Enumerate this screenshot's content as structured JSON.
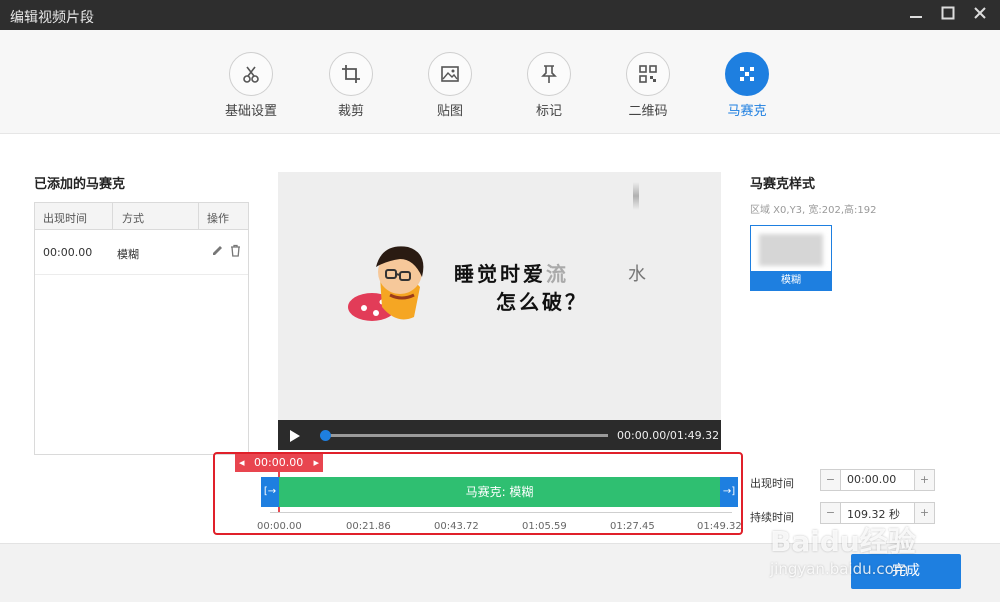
{
  "window": {
    "title": "编辑视频片段"
  },
  "toolbar": {
    "tabs": [
      {
        "label": "基础设置",
        "icon": "scissors-icon"
      },
      {
        "label": "裁剪",
        "icon": "crop-icon"
      },
      {
        "label": "贴图",
        "icon": "image-icon"
      },
      {
        "label": "标记",
        "icon": "pin-icon"
      },
      {
        "label": "二维码",
        "icon": "qrcode-icon"
      },
      {
        "label": "马赛克",
        "icon": "mosaic-icon",
        "active": true
      }
    ]
  },
  "added_list": {
    "title": "已添加的马赛克",
    "columns": [
      "出现时间",
      "方式",
      "操作"
    ],
    "rows": [
      {
        "time": "00:00.00",
        "mode": "模糊"
      }
    ]
  },
  "player": {
    "caption_line1": "睡觉时爱",
    "caption_line1_tail": "流",
    "caption_water": "水",
    "caption_line2": "怎么破？",
    "time": "00:00.00/01:49.32",
    "progress": 0.0
  },
  "mosaic_style": {
    "title": "马赛克样式",
    "region": "区域 X0,Y3, 宽:202,高:192",
    "selected": "模糊"
  },
  "timeline": {
    "current_tag": "00:00.00",
    "clip_label": "马赛克: 模糊",
    "ticks": [
      "00:00.00",
      "00:21.86",
      "00:43.72",
      "01:05.59",
      "01:27.45",
      "01:49.32"
    ]
  },
  "fields": {
    "appear_label": "出现时间",
    "appear_value": "00:00.00",
    "duration_label": "持续时间",
    "duration_value": "109.32 秒"
  },
  "footer": {
    "finish_label": "完成"
  },
  "watermark": {
    "brand": "Baidu经验",
    "url": "jingyan.baidu.com"
  },
  "colors": {
    "accent": "#1e7fe0",
    "clip": "#2fbf71",
    "highlight": "#e0202a"
  }
}
